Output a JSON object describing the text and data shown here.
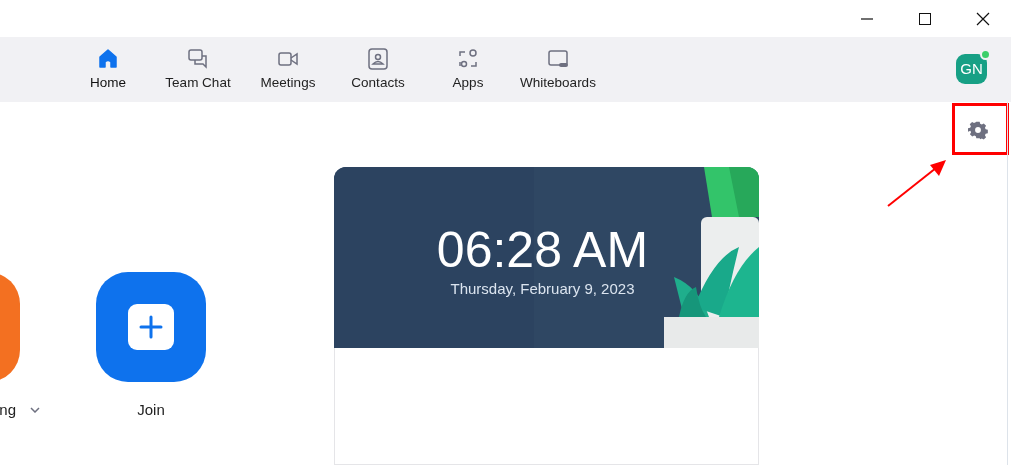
{
  "window": {
    "controls": [
      {
        "kind": "minimize"
      },
      {
        "kind": "maximize"
      },
      {
        "kind": "close"
      }
    ]
  },
  "tabs": [
    {
      "label": "Home",
      "kind": "home",
      "selected": true
    },
    {
      "label": "Team Chat",
      "kind": "chat",
      "selected": false
    },
    {
      "label": "Meetings",
      "kind": "video",
      "selected": false
    },
    {
      "label": "Contacts",
      "kind": "contacts",
      "selected": false
    },
    {
      "label": "Apps",
      "kind": "apps",
      "selected": false
    },
    {
      "label": "Whiteboards",
      "kind": "whiteboard",
      "selected": false
    }
  ],
  "profile": {
    "initials": "GN",
    "online": true
  },
  "actions": [
    {
      "label": "ng",
      "color": "#f37021",
      "kind": "start",
      "dropdown": true
    },
    {
      "label": "Join",
      "color": "#0e72ed",
      "kind": "join",
      "dropdown": false
    }
  ],
  "clock": {
    "time": "06:28 AM",
    "date": "Thursday, February 9, 2023"
  }
}
